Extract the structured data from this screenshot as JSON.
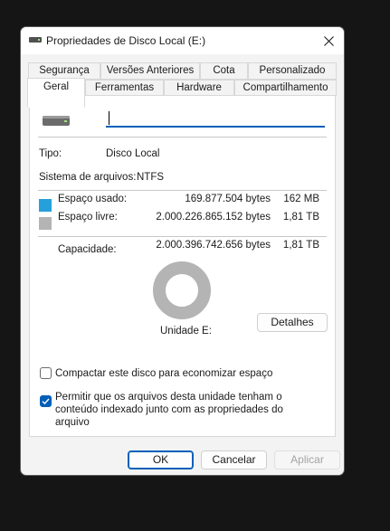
{
  "window": {
    "title": "Propriedades de Disco Local (E:)"
  },
  "tabs_top": [
    {
      "label": "Segurança"
    },
    {
      "label": "Versões Anteriores"
    },
    {
      "label": "Cota"
    },
    {
      "label": "Personalizado"
    }
  ],
  "tabs_bottom": [
    {
      "label": "Geral"
    },
    {
      "label": "Ferramentas"
    },
    {
      "label": "Hardware"
    },
    {
      "label": "Compartilhamento"
    }
  ],
  "general": {
    "name_value": "",
    "type_label": "Tipo:",
    "type_value": "Disco Local",
    "fs_label": "Sistema de arquivos:",
    "fs_value": "NTFS",
    "used_label": "Espaço usado:",
    "used_bytes": "169.877.504 bytes",
    "used_size": "162 MB",
    "free_label": "Espaço livre:",
    "free_bytes": "2.000.226.865.152 bytes",
    "free_size": "1,81 TB",
    "capacity_label": "Capacidade:",
    "capacity_bytes": "2.000.396.742.656 bytes",
    "capacity_size": "1,81 TB",
    "drive_label": "Unidade E:",
    "details_button": "Detalhes",
    "used_fraction": 8.49e-05
  },
  "options": {
    "compress_label": "Compactar este disco para economizar espaço",
    "compress_checked": false,
    "index_label": "Permitir que os arquivos desta unidade tenham o conteúdo indexado junto com as propriedades do arquivo",
    "index_checked": true
  },
  "buttons": {
    "ok": "OK",
    "cancel": "Cancelar",
    "apply": "Aplicar"
  },
  "colors": {
    "used": "#26a0da",
    "free": "#b4b4b4",
    "accent": "#005fb8"
  }
}
